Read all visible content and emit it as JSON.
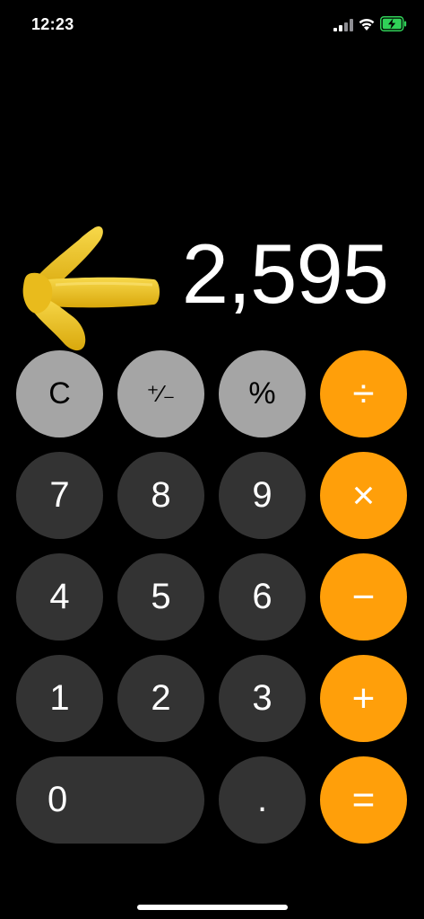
{
  "status_bar": {
    "time": "12:23",
    "icons": [
      "signal-icon",
      "wifi-icon",
      "battery-charging-icon"
    ],
    "battery_color": "#30d158"
  },
  "display": {
    "value": "2,595"
  },
  "sticker": {
    "name": "yellow-arrow-sticker",
    "color": "#f5c518"
  },
  "keys": {
    "clear": "C",
    "plus_minus": "⁺∕₋",
    "percent": "%",
    "divide": "÷",
    "seven": "7",
    "eight": "8",
    "nine": "9",
    "multiply": "×",
    "four": "4",
    "five": "5",
    "six": "6",
    "minus": "−",
    "one": "1",
    "two": "2",
    "three": "3",
    "plus": "+",
    "zero": "0",
    "decimal": ".",
    "equals": "="
  },
  "colors": {
    "function_key": "#a5a5a5",
    "digit_key": "#333333",
    "operator_key": "#ff9f0a",
    "background": "#000000"
  }
}
